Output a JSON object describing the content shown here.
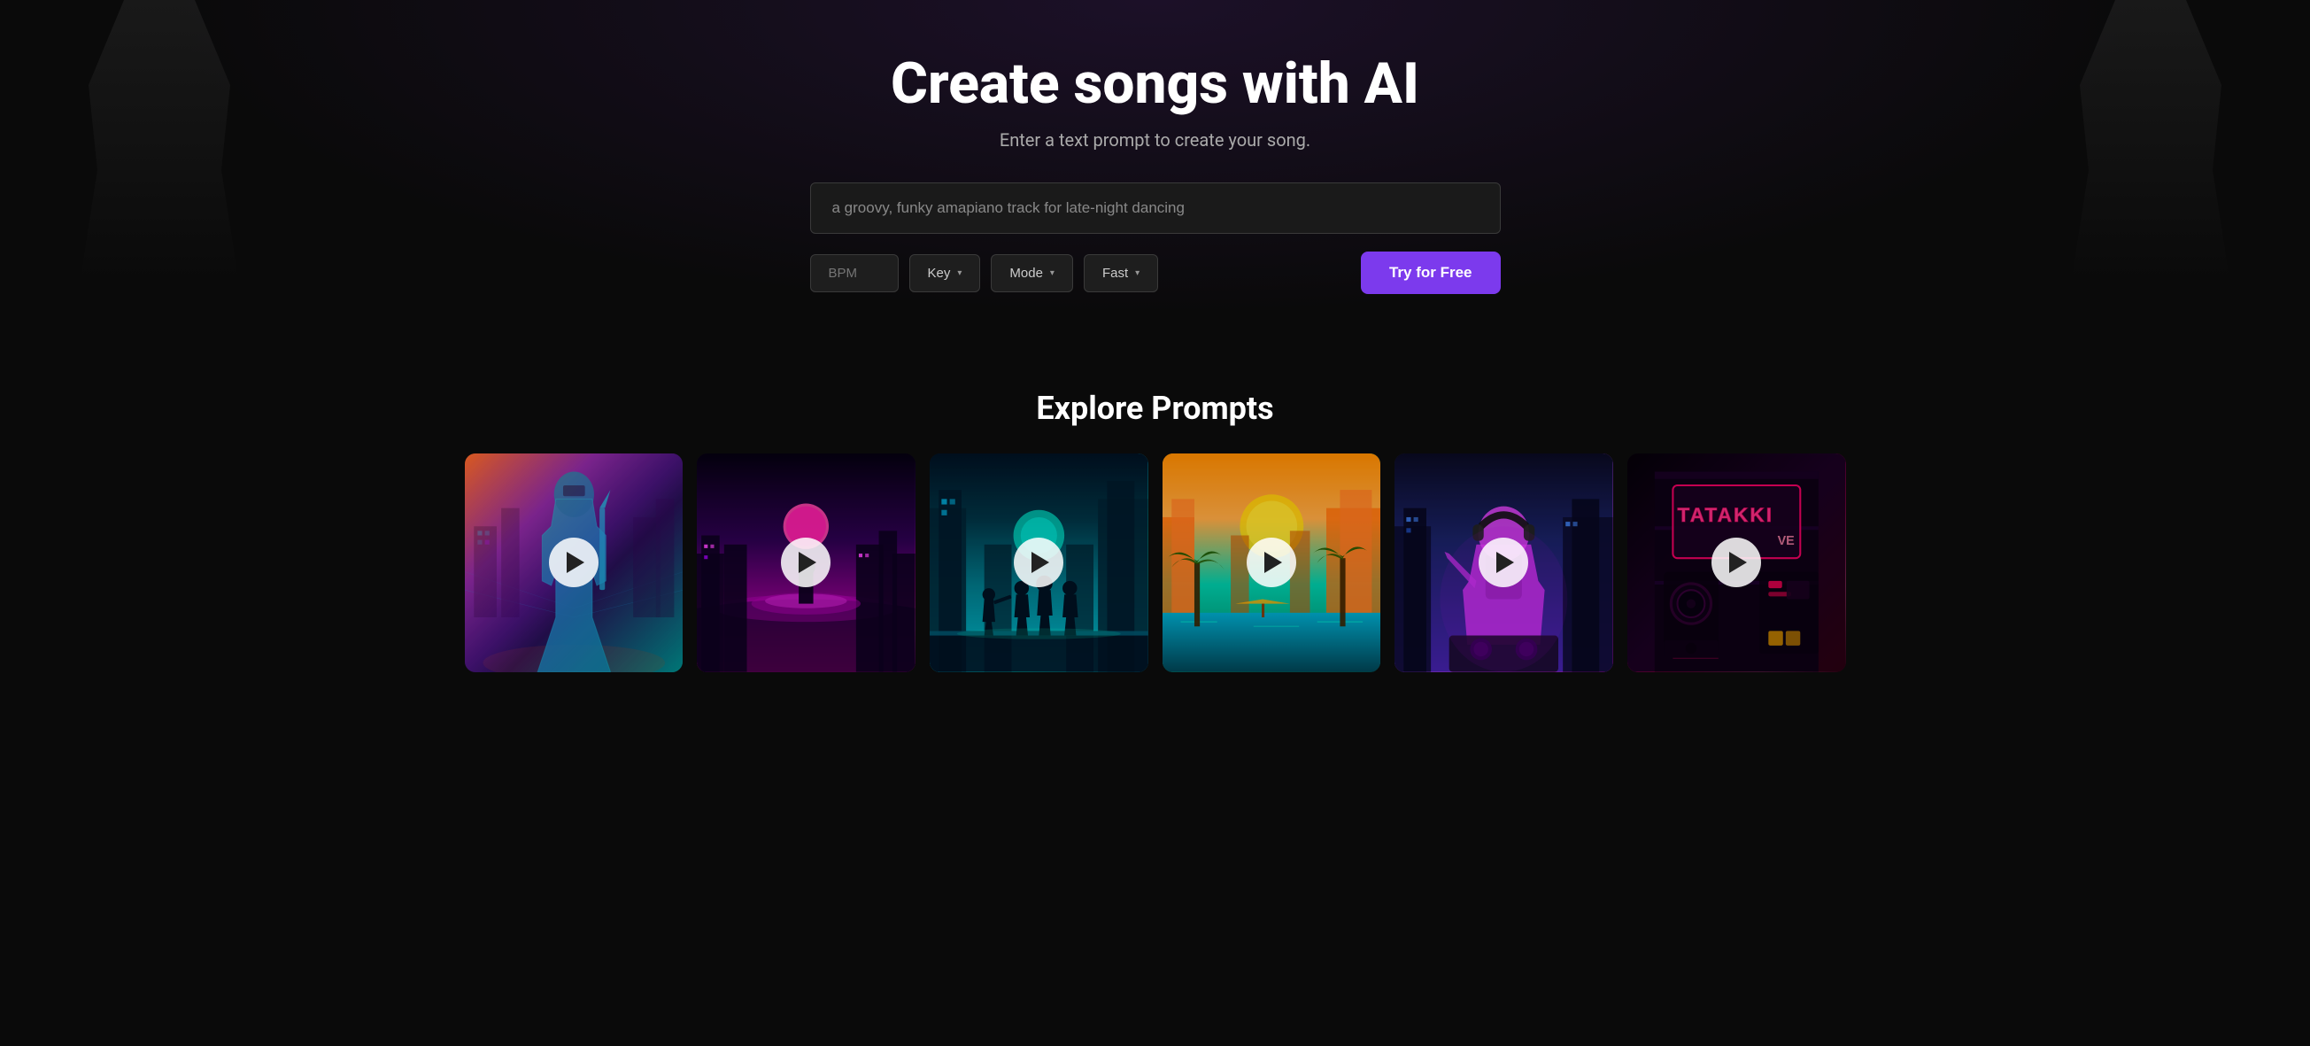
{
  "hero": {
    "title": "Create songs with AI",
    "subtitle": "Enter a text prompt to create your song.",
    "search": {
      "placeholder": "a groovy, funky amapiano track for late-night dancing",
      "value": ""
    },
    "controls": {
      "bpm_placeholder": "BPM",
      "key_label": "Key",
      "mode_label": "Mode",
      "speed_label": "Fast",
      "try_button_label": "Try for Free"
    }
  },
  "explore": {
    "section_title": "Explore Prompts",
    "prompts": [
      {
        "id": 1,
        "theme": "cyberpunk-warrior",
        "alt": "Cyberpunk warrior in neon city"
      },
      {
        "id": 2,
        "theme": "purple-city",
        "alt": "Purple retro synthwave city"
      },
      {
        "id": 3,
        "theme": "teal-band",
        "alt": "Teal cyberpunk band performance"
      },
      {
        "id": 4,
        "theme": "tropical-city",
        "alt": "Tropical golden city with palm trees"
      },
      {
        "id": 5,
        "theme": "dj-city",
        "alt": "DJ with headphones in blue city"
      },
      {
        "id": 6,
        "theme": "neon-sign",
        "alt": "Neon sign nightclub scene"
      }
    ]
  },
  "icons": {
    "chevron_down": "▾",
    "play": "▶"
  }
}
